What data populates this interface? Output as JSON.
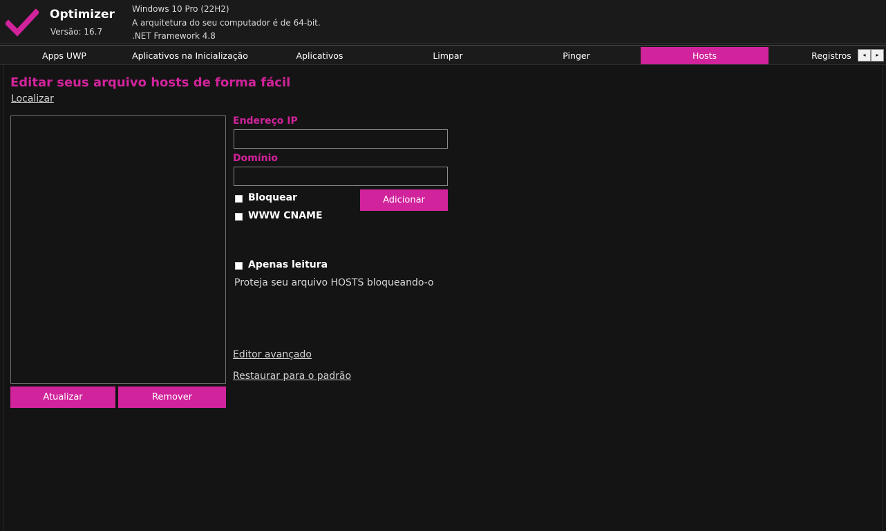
{
  "header": {
    "app_title": "Optimizer",
    "version": "Versão: 16.7",
    "os": "Windows 10 Pro (22H2)",
    "arch": "A arquitetura do seu computador é de 64-bit.",
    "framework": ".NET Framework 4.8"
  },
  "tabs": [
    {
      "label": "Apps UWP"
    },
    {
      "label": "Aplicativos na Inicialização"
    },
    {
      "label": "Aplicativos"
    },
    {
      "label": "Limpar"
    },
    {
      "label": "Pinger"
    },
    {
      "label": "Hosts",
      "active": true
    },
    {
      "label": "Registros"
    }
  ],
  "tab_scroll": {
    "left_glyph": "◂",
    "right_glyph": "▸"
  },
  "hosts": {
    "title": "Editar seus arquivo hosts de forma fácil",
    "locate_link": "Localizar",
    "ip_label": "Endereço IP",
    "ip_value": "",
    "domain_label": "Domínio",
    "domain_value": "",
    "block_label": "Bloquear",
    "cname_label": "WWW CNAME",
    "add_button": "Adicionar",
    "readonly_label": "Apenas leitura",
    "readonly_desc": "Proteja seu arquivo HOSTS bloqueando-o",
    "advanced_link": "Editor avançado",
    "restore_link": "Restaurar para o padrão",
    "refresh_button": "Atualizar",
    "remove_button": "Remover",
    "entries": []
  },
  "colors": {
    "accent": "#d1239b",
    "background": "#141414",
    "header_bg": "#1a1a1a",
    "text": "#ffffff"
  },
  "icons": {
    "logo": "checkmark-icon"
  }
}
